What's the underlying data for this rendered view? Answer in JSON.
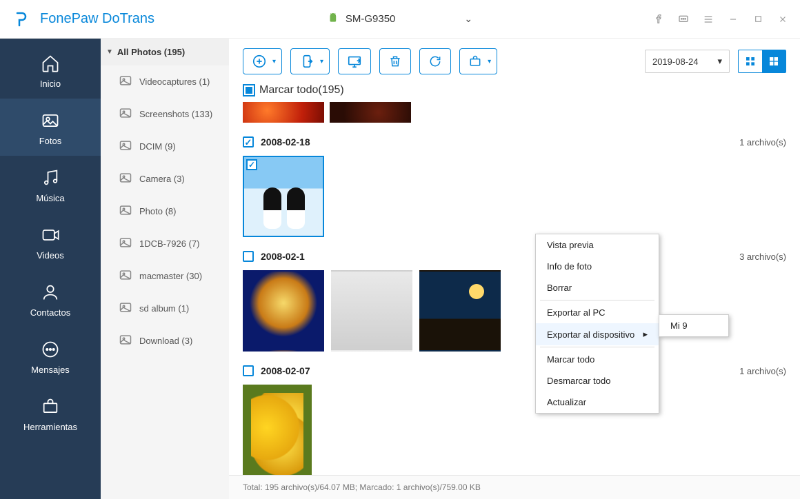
{
  "app_title": "FonePaw DoTrans",
  "device_name": "SM-G9350",
  "sidebar": [
    {
      "label": "Inicio"
    },
    {
      "label": "Fotos"
    },
    {
      "label": "Música"
    },
    {
      "label": "Videos"
    },
    {
      "label": "Contactos"
    },
    {
      "label": "Mensajes"
    },
    {
      "label": "Herramientas"
    }
  ],
  "albums_header": "All Photos (195)",
  "albums": [
    {
      "label": "Videocaptures (1)"
    },
    {
      "label": "Screenshots (133)"
    },
    {
      "label": "DCIM (9)"
    },
    {
      "label": "Camera (3)"
    },
    {
      "label": "Photo (8)"
    },
    {
      "label": "1DCB-7926 (7)"
    },
    {
      "label": "macmaster (30)"
    },
    {
      "label": "sd album (1)"
    },
    {
      "label": "Download (3)"
    }
  ],
  "date_filter": "2019-08-24",
  "mark_all_label": "Marcar todo(195)",
  "groups": [
    {
      "date": "2008-02-18",
      "count": "1 archivo(s)",
      "checked": true
    },
    {
      "date": "2008-02-1",
      "count": "3 archivo(s)",
      "checked": false
    },
    {
      "date": "2008-02-07",
      "count": "1 archivo(s)",
      "checked": false
    }
  ],
  "context_menu": {
    "items": [
      "Vista previa",
      "Info de foto",
      "Borrar",
      "Exportar al PC",
      "Exportar al dispositivo",
      "Marcar todo",
      "Desmarcar todo",
      "Actualizar"
    ],
    "submenu_item": "Mi 9"
  },
  "statusbar": "Total: 195 archivo(s)/64.07 MB; Marcado: 1 archivo(s)/759.00 KB"
}
